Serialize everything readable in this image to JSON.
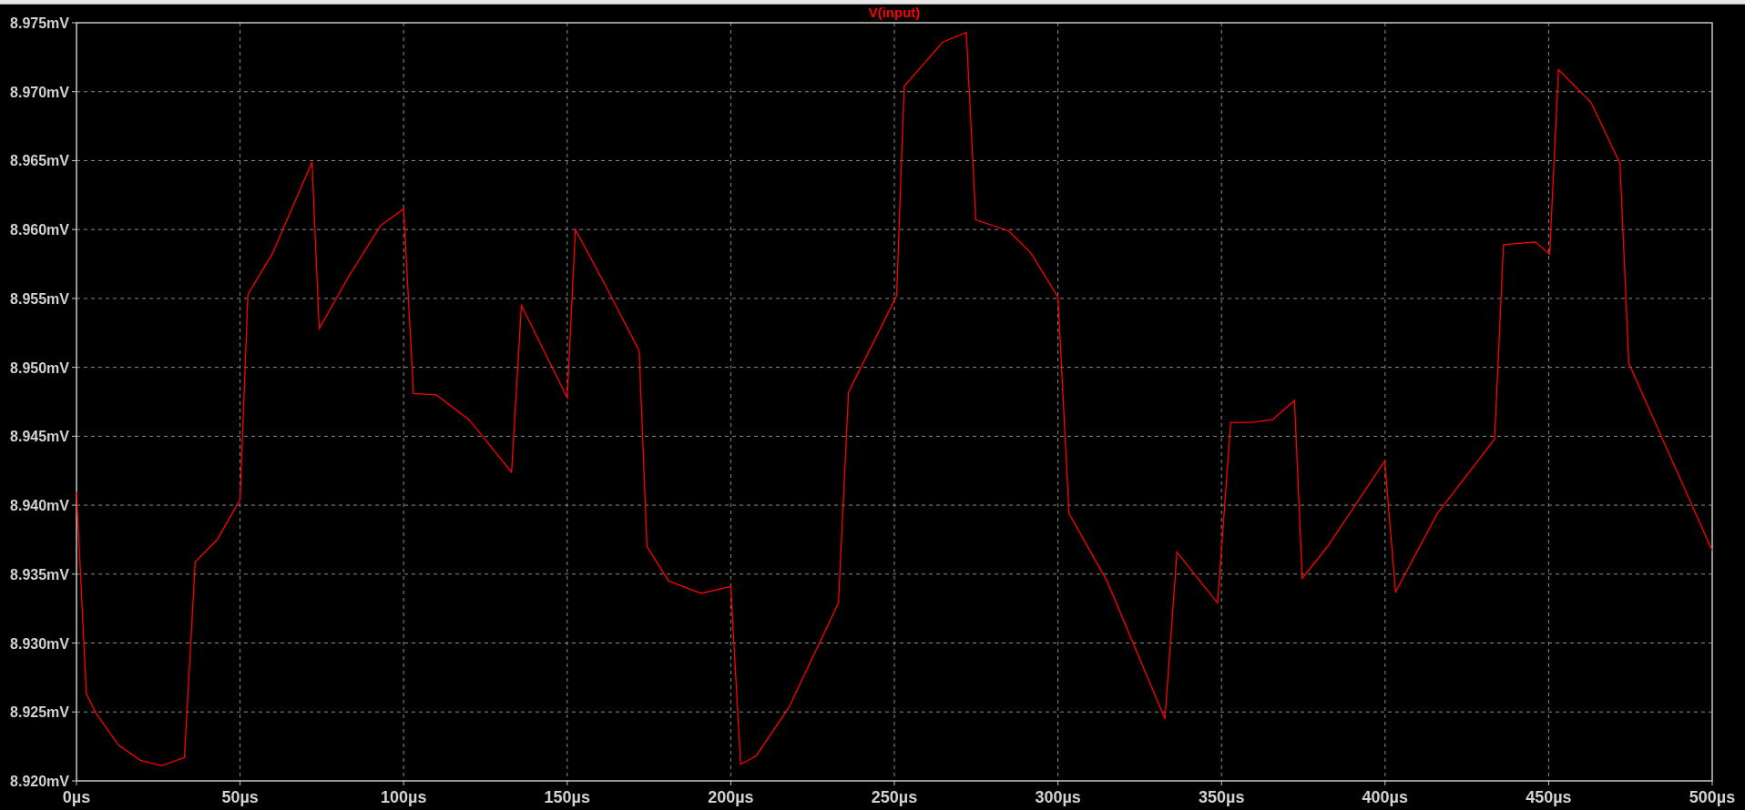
{
  "plot": {
    "chart_data": {
      "type": "line",
      "grid": true,
      "x": [
        0,
        3,
        6,
        12.8,
        19.5,
        26,
        33,
        36.3,
        43,
        50,
        52.4,
        60,
        72,
        74.2,
        83,
        93,
        100,
        103,
        110,
        120,
        133,
        136,
        150,
        152.5,
        162,
        172,
        174.4,
        181,
        190.9,
        200,
        203,
        207.7,
        217.7,
        232.9,
        236,
        248,
        250.7,
        253,
        264.8,
        272,
        274.9,
        285,
        291.7,
        300,
        303.4,
        315,
        332.7,
        336.4,
        348.8,
        352.8,
        358.9,
        365.6,
        372.3,
        374.7,
        382.4,
        399.9,
        403.2,
        416,
        433.5,
        436.2,
        446,
        450.3,
        453,
        463,
        471.8,
        474.5,
        500
      ],
      "series": [
        {
          "name": "V(input)",
          "color": "#ff0000",
          "values": [
            8.941,
            8.9263,
            8.9249,
            8.9226,
            8.9215,
            8.9211,
            8.9217,
            8.9359,
            8.9375,
            8.9404,
            8.9553,
            8.9583,
            8.9649,
            8.9528,
            8.9565,
            8.9603,
            8.9615,
            8.9481,
            8.948,
            8.9462,
            8.9424,
            8.9545,
            8.9478,
            8.96,
            8.9558,
            8.9512,
            8.937,
            8.9345,
            8.9336,
            8.9341,
            8.9212,
            8.9218,
            8.9253,
            8.9329,
            8.9482,
            8.9539,
            8.9552,
            8.9704,
            8.9736,
            8.9743,
            8.9607,
            8.9599,
            8.9583,
            8.9551,
            8.9394,
            8.9345,
            8.9245,
            8.9366,
            8.9329,
            8.946,
            8.946,
            8.9462,
            8.9476,
            8.9347,
            8.937,
            8.9432,
            8.9337,
            8.9394,
            8.9448,
            8.9589,
            8.9591,
            8.9582,
            8.9716,
            8.9692,
            8.9648,
            8.9503,
            8.9367
          ]
        }
      ],
      "xlim": [
        0,
        500
      ],
      "ylim": [
        8.92,
        8.975
      ],
      "xticks": [
        {
          "value": 0,
          "label": "0µs"
        },
        {
          "value": 50,
          "label": "50µs"
        },
        {
          "value": 100,
          "label": "100µs"
        },
        {
          "value": 150,
          "label": "150µs"
        },
        {
          "value": 200,
          "label": "200µs"
        },
        {
          "value": 250,
          "label": "250µs"
        },
        {
          "value": 300,
          "label": "300µs"
        },
        {
          "value": 350,
          "label": "350µs"
        },
        {
          "value": 400,
          "label": "400µs"
        },
        {
          "value": 450,
          "label": "450µs"
        },
        {
          "value": 500,
          "label": "500µs"
        }
      ],
      "yticks": [
        {
          "value": 8.92,
          "label": "8.920mV"
        },
        {
          "value": 8.925,
          "label": "8.925mV"
        },
        {
          "value": 8.93,
          "label": "8.930mV"
        },
        {
          "value": 8.935,
          "label": "8.935mV"
        },
        {
          "value": 8.94,
          "label": "8.940mV"
        },
        {
          "value": 8.945,
          "label": "8.945mV"
        },
        {
          "value": 8.95,
          "label": "8.950mV"
        },
        {
          "value": 8.955,
          "label": "8.955mV"
        },
        {
          "value": 8.96,
          "label": "8.960mV"
        },
        {
          "value": 8.965,
          "label": "8.965mV"
        },
        {
          "value": 8.97,
          "label": "8.970mV"
        },
        {
          "value": 8.975,
          "label": "8.975mV"
        }
      ]
    }
  }
}
